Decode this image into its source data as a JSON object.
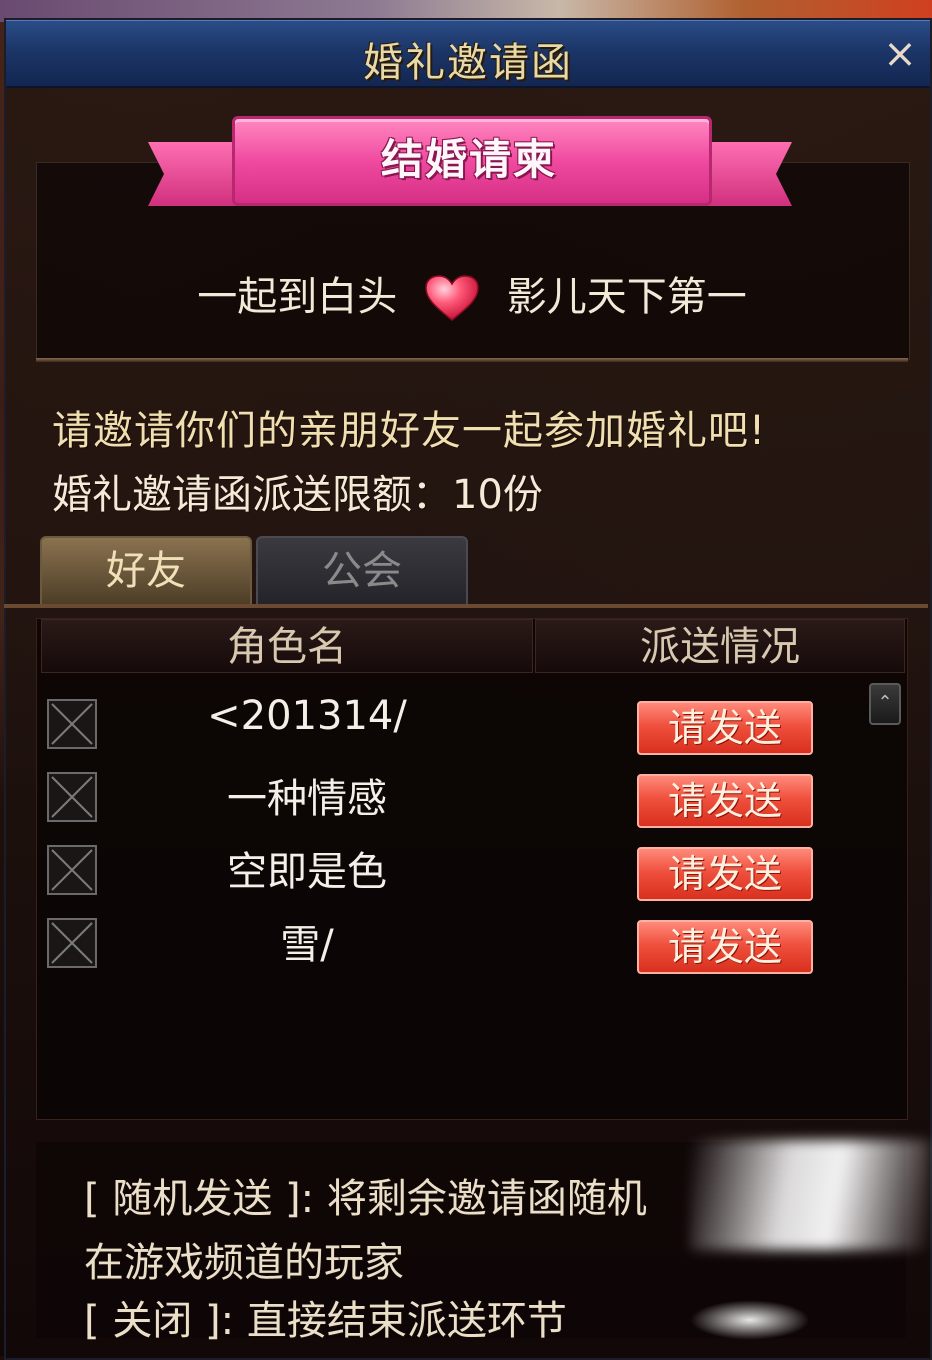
{
  "window": {
    "title": "婚礼邀请函",
    "close_label": "×"
  },
  "banner": {
    "title": "结婚请柬"
  },
  "couple": {
    "name1": "一起到白头",
    "name2": "影儿天下第一",
    "heart_icon": "heart-icon"
  },
  "info": {
    "invite_message": "请邀请你们的亲朋好友一起参加婚礼吧!",
    "quota_label": "婚礼邀请函派送限额：10份"
  },
  "tabs": [
    {
      "label": "好友",
      "active": true
    },
    {
      "label": "公会",
      "active": false
    }
  ],
  "table": {
    "columns": [
      "角色名",
      "派送情况"
    ],
    "rows": [
      {
        "name": "<201314/",
        "action": "请发送",
        "checked": false
      },
      {
        "name": "一种情感",
        "action": "请发送",
        "checked": false
      },
      {
        "name": "空即是色",
        "action": "请发送",
        "checked": false
      },
      {
        "name": "雪/",
        "action": "请发送",
        "checked": false
      }
    ]
  },
  "footer": {
    "line1": "[ 随机发送 ]: 将剩余邀请函随机",
    "line2": "在游戏频道的玩家",
    "line3": "[ 关闭 ]: 直接结束派送环节"
  },
  "colors": {
    "title_bar": "#1c3668",
    "ribbon": "#f04aa0",
    "send_button": "#f0503e",
    "invite_text": "#f0dfb0"
  }
}
